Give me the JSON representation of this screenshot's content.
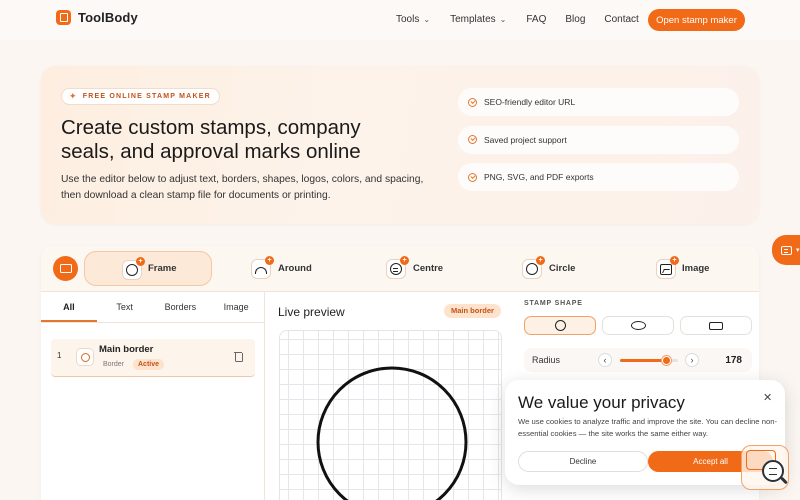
{
  "nav": {
    "brand": "ToolBody",
    "links": [
      {
        "label": "Tools",
        "has_menu": true
      },
      {
        "label": "Templates",
        "has_menu": true
      },
      {
        "label": "FAQ",
        "has_menu": false
      },
      {
        "label": "Blog",
        "has_menu": false
      },
      {
        "label": "Contact",
        "has_menu": false
      }
    ],
    "cta": "Open stamp maker"
  },
  "hero": {
    "badge": "FREE ONLINE STAMP MAKER",
    "title": "Create custom stamps, company seals, and approval marks online",
    "description": "Use the editor below to adjust text, borders, shapes, logos, colors, and spacing, then download a clean stamp file for documents or printing.",
    "features": [
      "SEO-friendly editor URL",
      "Saved project support",
      "PNG, SVG, and PDF exports"
    ]
  },
  "editor": {
    "tools": [
      {
        "label": "Frame",
        "icon": "frame-icon",
        "active": true
      },
      {
        "label": "Around",
        "icon": "around-icon",
        "active": false
      },
      {
        "label": "Centre",
        "icon": "centre-icon",
        "active": false
      },
      {
        "label": "Circle",
        "icon": "circle-icon",
        "active": false
      },
      {
        "label": "Image",
        "icon": "image-icon",
        "active": false
      }
    ],
    "layer_tabs": [
      "All",
      "Text",
      "Borders",
      "Image"
    ],
    "active_layer_tab": "All",
    "layers": [
      {
        "index": "1",
        "name": "Main border",
        "type": "Border",
        "status": "Active"
      }
    ],
    "preview": {
      "title": "Live preview",
      "selected_chip": "Main border"
    },
    "shape": {
      "label": "STAMP SHAPE",
      "options": [
        "circle",
        "oval",
        "rectangle"
      ],
      "selected": "circle"
    },
    "controls": [
      {
        "label": "Radius",
        "value": "178",
        "fraction": 0.8
      }
    ],
    "accent_color": "#f06a17"
  },
  "cookie": {
    "title": "We value your privacy",
    "text": "We use cookies to analyze traffic and improve the site. You can decline non-essential cookies — the site works the same either way.",
    "decline": "Decline",
    "accept": "Accept all"
  }
}
